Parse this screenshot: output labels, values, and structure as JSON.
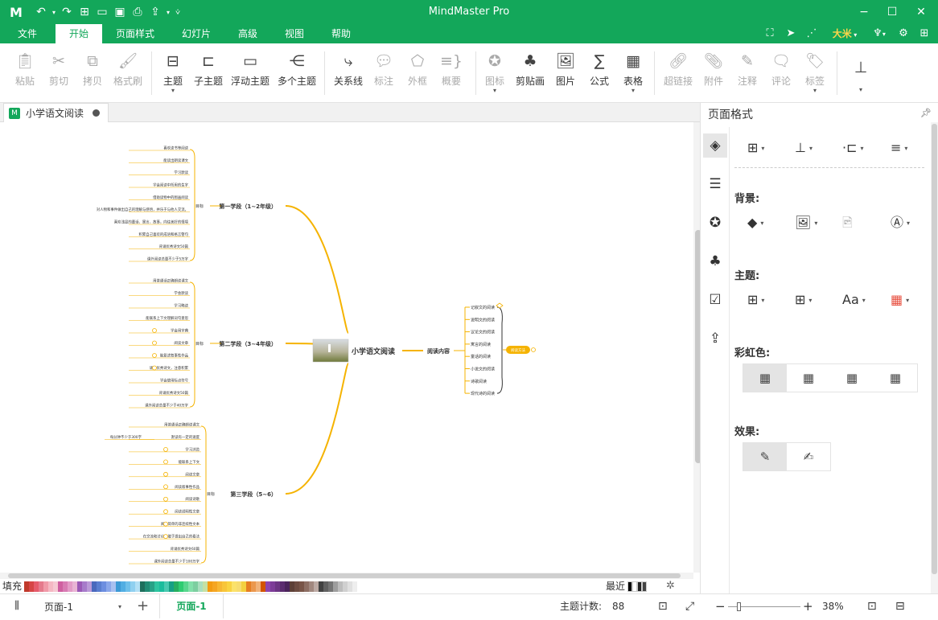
{
  "app": {
    "title": "MindMaster Pro"
  },
  "quick_access": [
    "undo-icon",
    "redo-icon",
    "new-icon",
    "open-icon",
    "save-icon",
    "print-icon",
    "export-icon",
    "more-icon"
  ],
  "menu_tabs": [
    {
      "label": "文件"
    },
    {
      "label": "开始"
    },
    {
      "label": "页面样式"
    },
    {
      "label": "幻灯片"
    },
    {
      "label": "高级"
    },
    {
      "label": "视图"
    },
    {
      "label": "帮助"
    }
  ],
  "menu_right": {
    "user": "大米"
  },
  "ribbon": {
    "clipboard": [
      {
        "label": "粘贴",
        "icon": "paste-icon",
        "enabled": false
      },
      {
        "label": "剪切",
        "icon": "cut-icon",
        "enabled": false
      },
      {
        "label": "拷贝",
        "icon": "copy-icon",
        "enabled": false
      },
      {
        "label": "格式刷",
        "icon": "format-painter-icon",
        "enabled": false
      }
    ],
    "insert_topic": [
      {
        "label": "主题",
        "icon": "topic-icon"
      },
      {
        "label": "子主题",
        "icon": "subtopic-icon"
      },
      {
        "label": "浮动主题",
        "icon": "floating-topic-icon"
      },
      {
        "label": "多个主题",
        "icon": "multiple-topics-icon"
      }
    ],
    "relations": [
      {
        "label": "关系线",
        "icon": "relationship-icon",
        "enabled": true
      },
      {
        "label": "标注",
        "icon": "callout-icon",
        "enabled": false
      },
      {
        "label": "外框",
        "icon": "boundary-icon",
        "enabled": false
      },
      {
        "label": "概要",
        "icon": "summary-icon",
        "enabled": false
      }
    ],
    "insert": [
      {
        "label": "图标",
        "icon": "mark-icon",
        "enabled": false
      },
      {
        "label": "剪贴画",
        "icon": "clipart-icon",
        "enabled": true
      },
      {
        "label": "图片",
        "icon": "picture-icon",
        "enabled": true
      },
      {
        "label": "公式",
        "icon": "formula-icon",
        "enabled": true
      },
      {
        "label": "表格",
        "icon": "table-icon",
        "enabled": true
      }
    ],
    "annotate": [
      {
        "label": "超链接",
        "icon": "hyperlink-icon",
        "enabled": false
      },
      {
        "label": "附件",
        "icon": "attachment-icon",
        "enabled": false
      },
      {
        "label": "注释",
        "icon": "note-icon",
        "enabled": false
      },
      {
        "label": "评论",
        "icon": "comment-icon",
        "enabled": false
      },
      {
        "label": "标签",
        "icon": "tag-icon",
        "enabled": false
      }
    ]
  },
  "document": {
    "tab_title": "小学语文阅读"
  },
  "mindmap": {
    "central": "小学语文阅读",
    "right_branch": {
      "label": "阅读内容",
      "children": [
        "记叙文的阅读",
        "说明文的阅读",
        "议论文的阅读",
        "寓言的阅读",
        "童话的阅读",
        "小说文的阅读",
        "诗歌阅读",
        "现代诗的阅读"
      ],
      "summary": "阅读方法"
    },
    "stages": [
      {
        "label": "第一学段（1~2年级）",
        "key": "目标",
        "items": [
          "喜欢读书等阅读",
          "能读出朗读课文",
          "学习默读",
          "学会阅读中所用的生字",
          "借助读物中的图画阅读",
          "对人物和事件做出自己的理解与感悟，并乐于与他人交流。",
          "喜欢浅显的童话、寓言、故事，向往美好的情境",
          "积累自己喜欢的成语和格言警句",
          "背诵优秀诗文50篇",
          "课外阅读总量不少于5万字"
        ]
      },
      {
        "label": "第二学段（3~4年级）",
        "key": "目标",
        "items": [
          "用普通话正确朗读课文",
          "学会默读",
          "学习略读",
          "能联系上下文理解词句意思",
          "学会用字典",
          "阅读文章",
          "能复述叙事性作品",
          "诵读优秀诗文，注意积累",
          "学会使用标点符号",
          "背诵优秀诗文50篇",
          "课外阅读总量不少于40万字"
        ]
      },
      {
        "label": "第三学段（5~6）",
        "key": "目标",
        "items": [
          "用普通话正确朗读课文",
          "默读有一定的速度",
          "学习浏览",
          "能联系上下文",
          "阅读文章",
          "阅读叙事性作品",
          "阅读诗歌",
          "阅读说明性文章",
          "阅读简单的非连续性文本",
          "在交流和讨论中敢于提出自己的看法",
          "背诵优秀诗文60篇",
          "课外阅读总量不少于100万字"
        ],
        "side_note": "每分钟不少于300字"
      }
    ]
  },
  "colorbar": {
    "fill_label": "填充",
    "recent_label": "最近",
    "swatches": [
      "#c0392b",
      "#d64545",
      "#e55b6b",
      "#e57a8c",
      "#f09aa8",
      "#f5b8c3",
      "#f6c9d2",
      "#cf5fa0",
      "#d87bb3",
      "#e39bc7",
      "#e9b4d4",
      "#9b59b6",
      "#a77bca",
      "#bb9ad8",
      "#4a69bd",
      "#5a7ed0",
      "#6c8ee0",
      "#8aa7ea",
      "#a9c0f0",
      "#3d9ad6",
      "#52aee3",
      "#6fc0ea",
      "#90d0f0",
      "#b3e0f5",
      "#1e6f5c",
      "#218c74",
      "#27a186",
      "#2ec4a0",
      "#1abc9c",
      "#48c9b0",
      "#16a085",
      "#27ae60",
      "#2ecc71",
      "#58d68d",
      "#82e0aa",
      "#7dcea0",
      "#a9dfbf",
      "#c5e1a5",
      "#f39c12",
      "#f5a623",
      "#f7b733",
      "#f8c53a",
      "#f9d342",
      "#fbe26a",
      "#f7dc6f",
      "#f4d03f",
      "#e67e22",
      "#eb984e",
      "#f0b27a",
      "#d35400",
      "#8e44ad",
      "#7d3c98",
      "#6c3483",
      "#5b2c6f",
      "#4a235a",
      "#5d4037",
      "#6d4c41",
      "#795548",
      "#8d6e63",
      "#a1887f",
      "#bcaaa4",
      "#424242",
      "#616161",
      "#757575",
      "#9e9e9e",
      "#bdbdbd",
      "#d0d0d0",
      "#e0e0e0",
      "#eeeeee",
      "#ffffff"
    ],
    "recent": [
      "#000000",
      "#ffffff",
      "#222222",
      "#444444"
    ]
  },
  "statusbar": {
    "page_select": "页面-1",
    "active_page": "页面-1",
    "topic_count_label": "主题计数:",
    "topic_count": "88",
    "zoom": "38%",
    "zoom_fraction": 0.38
  },
  "panel": {
    "title": "页面格式",
    "background_label": "背景:",
    "theme_label": "主题:",
    "rainbow_label": "彩虹色:",
    "effect_label": "效果:",
    "tabs": [
      "page-format-icon",
      "outline-icon",
      "mark-panel-icon",
      "clipart-panel-icon",
      "task-icon",
      "export-panel-icon"
    ]
  }
}
